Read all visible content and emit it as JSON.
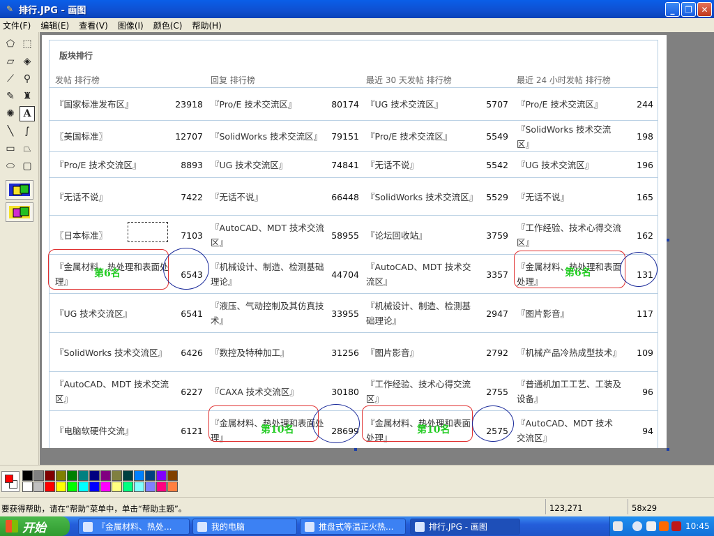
{
  "window": {
    "title": "排行.JPG - 画图"
  },
  "menu": [
    "文件(F)",
    "编辑(E)",
    "查看(V)",
    "图像(I)",
    "颜色(C)",
    "帮助(H)"
  ],
  "tools": [
    "free-select-icon",
    "rect-select-icon",
    "eraser-icon",
    "fill-icon",
    "picker-icon",
    "magnifier-icon",
    "pencil-icon",
    "brush-icon",
    "airbrush-icon",
    "text-icon",
    "line-icon",
    "curve-icon",
    "rectangle-icon",
    "polygon-icon",
    "ellipse-icon",
    "rounded-rect-icon"
  ],
  "table": {
    "title": "版块排行",
    "columns": [
      "发帖 排行榜",
      "回复 排行榜",
      "最近 30 天发帖 排行榜",
      "最近 24 小时发帖 排行榜"
    ],
    "rows": [
      [
        [
          "『国家标准发布区』",
          "23918"
        ],
        [
          "『Pro/E 技术交流区』",
          "80174"
        ],
        [
          "『UG 技术交流区』",
          "5707"
        ],
        [
          "『Pro/E 技术交流区』",
          "244"
        ]
      ],
      [
        [
          "〖美国标准〗",
          "12707"
        ],
        [
          "『SolidWorks 技术交流区』",
          "79151"
        ],
        [
          "『Pro/E 技术交流区』",
          "5549"
        ],
        [
          "『SolidWorks 技术交流区』",
          "198"
        ]
      ],
      [
        [
          "『Pro/E 技术交流区』",
          "8893"
        ],
        [
          "『UG 技术交流区』",
          "74841"
        ],
        [
          "『无话不说』",
          "5542"
        ],
        [
          "『UG 技术交流区』",
          "196"
        ]
      ],
      [
        [
          "『无话不说』",
          "7422"
        ],
        [
          "『无话不说』",
          "66448"
        ],
        [
          "『SolidWorks 技术交流区』",
          "5529"
        ],
        [
          "『无话不说』",
          "165"
        ]
      ],
      [
        [
          "〖日本标准〗",
          "7103"
        ],
        [
          "『AutoCAD、MDT 技术交流区』",
          "58955"
        ],
        [
          "『论坛回收站』",
          "3759"
        ],
        [
          "『工作经验、技术心得交流区』",
          "162"
        ]
      ],
      [
        [
          "『金属材料、热处理和表面处理』",
          "6543"
        ],
        [
          "『机械设计、制造、检测基础理论』",
          "44704"
        ],
        [
          "『AutoCAD、MDT 技术交流区』",
          "3357"
        ],
        [
          "『金属材料、热处理和表面处理』",
          "131"
        ]
      ],
      [
        [
          "『UG 技术交流区』",
          "6541"
        ],
        [
          "『液压、气动控制及其仿真技术』",
          "33955"
        ],
        [
          "『机械设计、制造、检测基础理论』",
          "2947"
        ],
        [
          "『图片影音』",
          "117"
        ]
      ],
      [
        [
          "『SolidWorks 技术交流区』",
          "6426"
        ],
        [
          "『数控及特种加工』",
          "31256"
        ],
        [
          "『图片影音』",
          "2792"
        ],
        [
          "『机械产品冷热成型技术』",
          "109"
        ]
      ],
      [
        [
          "『AutoCAD、MDT 技术交流区』",
          "6227"
        ],
        [
          "『CAXA 技术交流区』",
          "30180"
        ],
        [
          "『工作经验、技术心得交流区』",
          "2755"
        ],
        [
          "『普通机加工工艺、工装及设备』",
          "96"
        ]
      ],
      [
        [
          "『电脑软硬件交流』",
          "6121"
        ],
        [
          "『金属材料、热处理和表面处理』",
          "28699"
        ],
        [
          "『金属材料、热处理和表面处理』",
          "2575"
        ],
        [
          "『AutoCAD、MDT 技术交流区』",
          "94"
        ]
      ]
    ],
    "annotations": {
      "rank6": "第6名",
      "rank10": "第10名"
    }
  },
  "palette": {
    "foreground": "#ff0000",
    "background": "#ffffff",
    "colors_top": [
      "#000000",
      "#808080",
      "#800000",
      "#808000",
      "#008000",
      "#008080",
      "#000080",
      "#800080",
      "#808040",
      "#004040",
      "#0080ff",
      "#004080",
      "#8000ff",
      "#804000"
    ],
    "colors_bottom": [
      "#ffffff",
      "#c0c0c0",
      "#ff0000",
      "#ffff00",
      "#00ff00",
      "#00ffff",
      "#0000ff",
      "#ff00ff",
      "#ffff80",
      "#00ff80",
      "#80ffff",
      "#8080ff",
      "#ff0080",
      "#ff8040"
    ]
  },
  "status": {
    "help": "要获得帮助，请在“帮助”菜单中，单击“帮助主题”。",
    "coords": "123,271",
    "size": "58x29"
  },
  "taskbar": {
    "start": "开始",
    "tasks": [
      "『金属材料、热处...",
      "我的电脑",
      "推盘式等温正火热...",
      "排行.JPG - 画图"
    ],
    "clock": "10:45"
  }
}
